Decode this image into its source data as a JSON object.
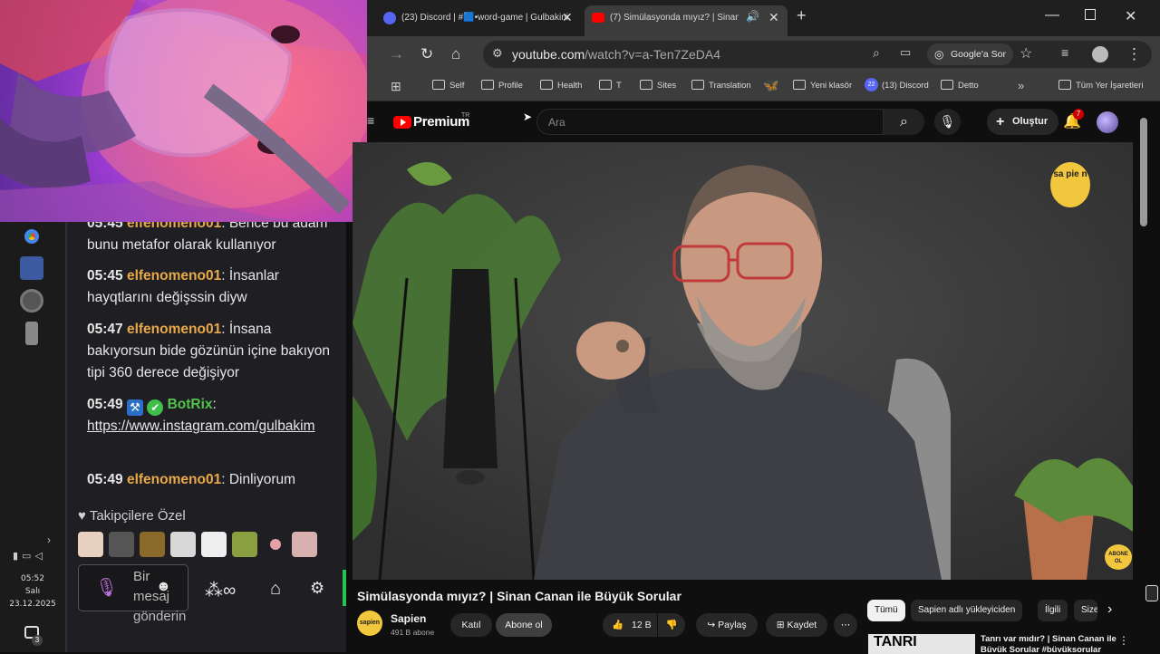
{
  "tabs": [
    {
      "label": "(23) Discord | #🟦•word-game | Gulbakini",
      "active": false
    },
    {
      "label": "(7) Simülasyonda mıyız? | Sinan Canan",
      "active": true
    }
  ],
  "address_bar": {
    "url_host": "youtube.com",
    "url_path": "/watch?v=a-Ten7ZeDA4",
    "google_sor_label": "Google'a Sor"
  },
  "bookmarks": {
    "items": [
      "Self",
      "Profile",
      "Health",
      "T",
      "Sites",
      "Translation",
      "Yeni klasör",
      "(13) Discord",
      "Detto"
    ],
    "discord_badge": "22",
    "all_bookmarks": "Tüm Yer İşaretleri"
  },
  "youtube": {
    "logo_text": "Premium",
    "logo_region": "TR",
    "search_placeholder": "Ara",
    "create_label": "Oluştur",
    "notifications_count": "7",
    "video_title": "Simülasyonda mıyız? | Sinan Canan ile Büyük Sorular",
    "channel_name": "Sapien",
    "channel_subscribers": "491 B abone",
    "join_label": "Katıl",
    "subscribe_label": "Abone ol",
    "like_count": "12 B",
    "share_label": "Paylaş",
    "save_label": "Kaydet",
    "chips": [
      "Tümü",
      "Sapien adlı yükleyiciden",
      "İlgili",
      "Size"
    ],
    "rec_thumb_text": "TANRI",
    "rec_title": "Tanrı var mıdır? | Sinan Canan ile Büyük Sorular #büyüksorular",
    "video_logo_text": "sa pie n",
    "video_corner_text": "ABONE OL"
  },
  "chat": {
    "messages": [
      {
        "time": "05:45",
        "user": "elfenomeno01",
        "text": "Bence bu adam bunu metafor olarak kullanıyor"
      },
      {
        "time": "05:45",
        "user": "elfenomeno01",
        "text": "İnsanlar hayqtlarını değişssin diyw"
      },
      {
        "time": "05:47",
        "user": "elfenomeno01",
        "text": "İnsana bakıyorsun bide gözünün içine bakıyon tipi 360 derece değişiyor"
      },
      {
        "time": "05:49",
        "user": "BotRix",
        "text": "https://www.instagram.com/gulbakim"
      },
      {
        "time": "05:49",
        "user": "elfenomeno01",
        "text": "Dinliyorum"
      }
    ],
    "followers_label": "Takipçilere Özel",
    "input_placeholder": "Bir mesaj gönderin"
  },
  "tray": {
    "time": "05:52",
    "day": "Salı",
    "date": "23.12.2025",
    "notif_count": "3"
  }
}
